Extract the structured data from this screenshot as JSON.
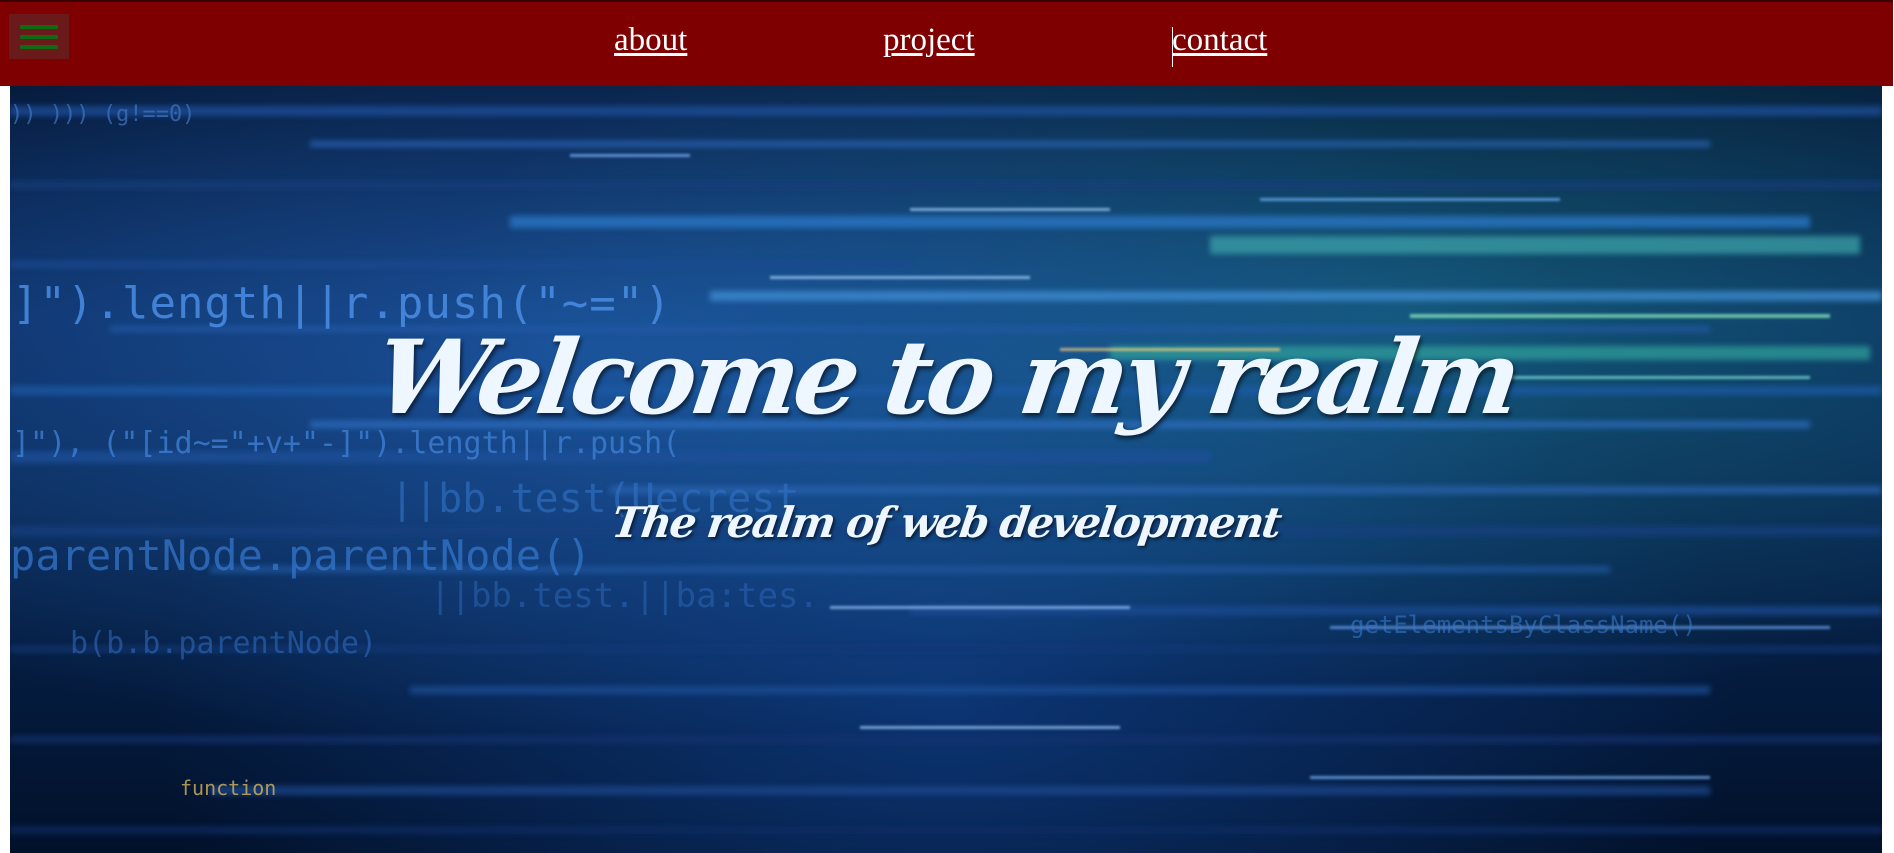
{
  "navbar": {
    "menu_icon": "hamburger-menu-icon",
    "links": [
      {
        "label": "about"
      },
      {
        "label": "project"
      },
      {
        "label": "contact"
      }
    ],
    "colors": {
      "background": "#7e0000",
      "menu_bar": "#0f6a12",
      "link": "#ffffff"
    }
  },
  "hero": {
    "title": "Welcome to my realm",
    "subtitle": "The realm of web development",
    "background_code": [
      "]\").length||r.push(\"~=\")",
      "]\"), (\"[id~=\"+v+\"-]\").length||r.push(",
      "||bb.test(Uecrest",
      "parentNode.parentNode()",
      "||bb.test.||ba:tes.",
      "b(b.b.parentNode)",
      "function",
      "getElementsByClassName()",
      "))    )))   (g!==0)"
    ]
  }
}
